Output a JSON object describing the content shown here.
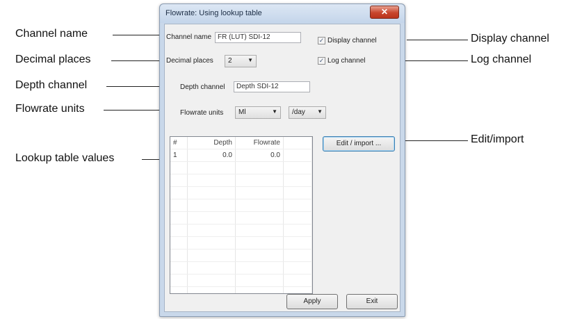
{
  "window": {
    "title": "Flowrate: Using lookup table",
    "close_glyph": "✕"
  },
  "form": {
    "channel_name_label": "Channel name",
    "channel_name_value": "FR (LUT) SDI-12",
    "decimal_places_label": "Decimal places",
    "decimal_places_value": "2",
    "display_channel_label": "Display channel",
    "log_channel_label": "Log channel",
    "depth_channel_label": "Depth channel",
    "depth_channel_value": "Depth SDI-12",
    "flowrate_units_label": "Flowrate units",
    "flowrate_volume_unit": "Ml",
    "flowrate_time_unit": "/day"
  },
  "table": {
    "headers": [
      "#",
      "Depth",
      "Flowrate"
    ],
    "rows": [
      [
        "1",
        "0.0",
        "0.0"
      ]
    ],
    "empty_rows": 11
  },
  "buttons": {
    "edit_import": "Edit / import ...",
    "apply": "Apply",
    "exit": "Exit"
  },
  "callouts": {
    "channel_name": "Channel name",
    "decimal_places": "Decimal places",
    "depth_channel": "Depth channel",
    "flowrate_units": "Flowrate units",
    "lookup_table_values": "Lookup table values",
    "display_channel": "Display channel",
    "log_channel": "Log channel",
    "edit_import": "Edit/import"
  },
  "icons": {
    "dropdown": "chevron-down-icon",
    "check": "checkmark-icon"
  }
}
